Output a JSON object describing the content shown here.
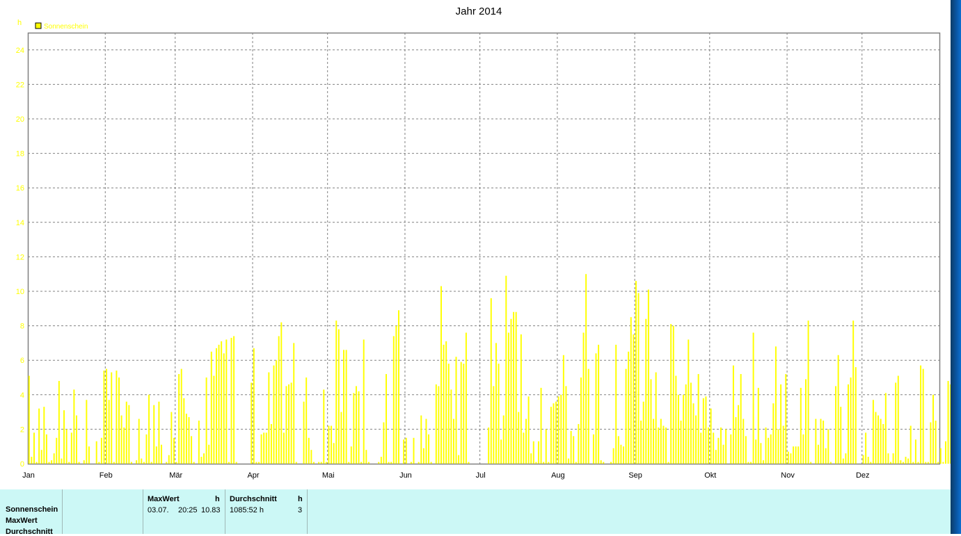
{
  "chart_data": {
    "type": "bar",
    "title": "Jahr 2014",
    "ylabel": "h",
    "ylim": [
      0,
      25
    ],
    "yticks": [
      "0",
      "2",
      "4",
      "6",
      "8",
      "10",
      "12",
      "14",
      "16",
      "18",
      "20",
      "22",
      "24"
    ],
    "x_tick_labels": [
      "Jan",
      "Feb",
      "Mär",
      "Apr",
      "Mai",
      "Jun",
      "Jul",
      "Aug",
      "Sep",
      "Okt",
      "Nov",
      "Dez"
    ],
    "x_unit": "day of year 2014",
    "grid": true,
    "legend_position": "top-left",
    "series": [
      {
        "name": "Sonnenschein",
        "color": "#ffff00",
        "values": [
          5.1,
          0.4,
          1.8,
          0.1,
          3.2,
          0.8,
          3.3,
          1.7,
          0.1,
          0.2,
          0.6,
          1.5,
          4.8,
          0.3,
          3.1,
          2.0,
          0.1,
          1.8,
          4.3,
          2.8,
          0.1,
          0.0,
          0.2,
          3.7,
          1.0,
          0.0,
          0.0,
          1.3,
          0.1,
          1.5,
          5.4,
          5.5,
          3.7,
          5.3,
          0.1,
          5.4,
          5.0,
          2.8,
          2.1,
          3.6,
          3.4,
          0.1,
          0.0,
          0.2,
          2.6,
          0.3,
          0.1,
          1.7,
          4.0,
          0.1,
          3.4,
          1.0,
          3.6,
          1.1,
          0.0,
          0.1,
          0.5,
          3.0,
          1.5,
          0.1,
          5.2,
          5.5,
          3.8,
          2.9,
          2.7,
          1.6,
          0.1,
          0.0,
          2.5,
          0.4,
          0.6,
          5.0,
          1.1,
          6.5,
          5.1,
          6.7,
          6.9,
          7.1,
          6.4,
          7.2,
          0.1,
          7.3,
          7.4,
          0.1,
          0.0,
          0.0,
          0.0,
          0.0,
          0.0,
          4.7,
          6.7,
          0.1,
          0.1,
          1.7,
          1.8,
          1.8,
          5.3,
          2.3,
          5.7,
          6.0,
          7.4,
          8.2,
          1.8,
          4.5,
          4.6,
          4.7,
          7.0,
          0.1,
          0.0,
          0.0,
          3.6,
          5.0,
          1.5,
          0.8,
          0.1,
          0.0,
          0.1,
          0.1,
          4.3,
          0.1,
          2.2,
          2.2,
          1.2,
          8.3,
          7.8,
          3.0,
          6.6,
          6.6,
          0.1,
          1.0,
          4.1,
          4.5,
          4.2,
          0.1,
          7.2,
          0.8,
          0.1,
          0.0,
          0.0,
          0.0,
          0.1,
          0.4,
          2.4,
          5.2,
          0.1,
          0.1,
          7.4,
          8.0,
          8.9,
          0.0,
          1.4,
          1.5,
          0.0,
          0.1,
          1.5,
          0.0,
          0.1,
          2.8,
          0.9,
          2.6,
          1.7,
          0.1,
          0.0,
          4.6,
          4.5,
          10.3,
          6.9,
          7.1,
          5.8,
          4.3,
          2.6,
          6.2,
          0.5,
          5.9,
          5.8,
          7.6,
          0.1,
          0.0,
          0.0,
          0.0,
          0.0,
          0.0,
          0.0,
          0.0,
          2.1,
          9.6,
          4.5,
          7.0,
          5.8,
          1.4,
          2.8,
          10.9,
          7.6,
          8.4,
          8.8,
          8.8,
          3.0,
          7.5,
          1.8,
          2.6,
          3.9,
          0.6,
          1.3,
          0.1,
          1.3,
          4.4,
          0.1,
          2.0,
          0.1,
          3.3,
          3.5,
          3.6,
          3.9,
          4.0,
          6.3,
          4.5,
          0.3,
          1.9,
          1.6,
          0.1,
          2.3,
          5.0,
          7.6,
          11.0,
          5.5,
          0.0,
          1.7,
          6.4,
          6.9,
          0.2,
          0.1,
          0.0,
          0.0,
          0.1,
          0.9,
          6.9,
          1.6,
          1.1,
          1.0,
          5.5,
          6.5,
          8.5,
          7.5,
          10.6,
          9.9,
          2.5,
          3.6,
          8.4,
          10.1,
          4.9,
          2.6,
          5.3,
          2.1,
          2.6,
          2.2,
          2.1,
          0.1,
          8.1,
          8.0,
          5.1,
          4.0,
          2.5,
          4.0,
          4.6,
          7.2,
          4.7,
          3.5,
          2.8,
          5.2,
          1.8,
          3.8,
          3.9,
          2.1,
          3.2,
          1.8,
          0.8,
          1.5,
          2.1,
          1.1,
          2.0,
          0.0,
          1.7,
          5.7,
          2.7,
          3.4,
          5.2,
          2.6,
          1.6,
          0.1,
          0.1,
          7.6,
          1.4,
          4.4,
          1.2,
          0.2,
          2.1,
          1.5,
          1.7,
          3.5,
          6.8,
          2.0,
          4.6,
          2.2,
          5.2,
          0.7,
          0.6,
          1.0,
          1.0,
          1.0,
          4.4,
          1.7,
          4.9,
          8.3,
          0.1,
          0.0,
          2.6,
          1.1,
          2.6,
          2.5,
          0.9,
          2.0,
          0.1,
          0.0,
          4.5,
          6.3,
          3.3,
          0.3,
          0.6,
          4.6,
          5.0,
          8.3,
          5.6,
          0.0,
          0.0,
          0.5,
          1.8,
          0.4,
          0.1,
          3.7,
          3.0,
          2.8,
          2.6,
          2.3,
          4.1,
          0.6,
          0.1,
          0.6,
          4.7,
          5.1,
          0.2,
          0.1,
          0.4,
          0.3,
          2.2,
          0.1,
          1.4,
          0.1,
          5.7,
          5.5,
          0.1,
          0.1,
          2.4,
          4.0,
          2.5,
          0.1,
          0.9,
          0.1,
          1.3,
          4.8,
          4.6,
          0.7,
          0.4,
          1.2,
          0.1,
          1.3,
          0.1,
          1.2,
          0.0,
          0.0,
          0.1,
          2.0,
          0.0,
          0.0,
          0.0,
          0.0,
          0.0,
          5.7,
          4.2,
          5.3,
          3.3,
          5.6,
          3.0,
          0.1,
          2.7,
          0.1,
          5.0,
          0.0,
          0.0,
          0.0,
          0.0,
          2.9,
          0.1,
          0.0,
          0.0,
          0.0,
          0.0,
          0.0,
          0.0,
          2.5,
          2.8,
          0.7,
          0.1,
          0.0,
          0.0,
          0.0,
          0.1,
          4.8,
          0.1,
          0.1,
          0.1,
          0.0,
          0.0,
          0.0,
          0.0,
          0.0,
          0.0,
          0.0,
          0.0,
          0.0,
          0.0,
          0.0,
          1.2
        ]
      }
    ]
  },
  "stats": {
    "row_labels": [
      "Sonnenschein",
      "MaxWert",
      "Durchschnitt"
    ],
    "maxwert": {
      "header": "MaxWert",
      "unit": "h",
      "date": "03.07.",
      "time": "20:25",
      "value": "10.83"
    },
    "durchschnitt": {
      "header": "Durchschnitt",
      "unit": "h",
      "total": "1085:52 h",
      "value": "3"
    }
  },
  "colors": {
    "bar": "#ffff00",
    "axis_text": "#ffff00",
    "grid": "#808080",
    "panel": "#ccf8f6"
  }
}
